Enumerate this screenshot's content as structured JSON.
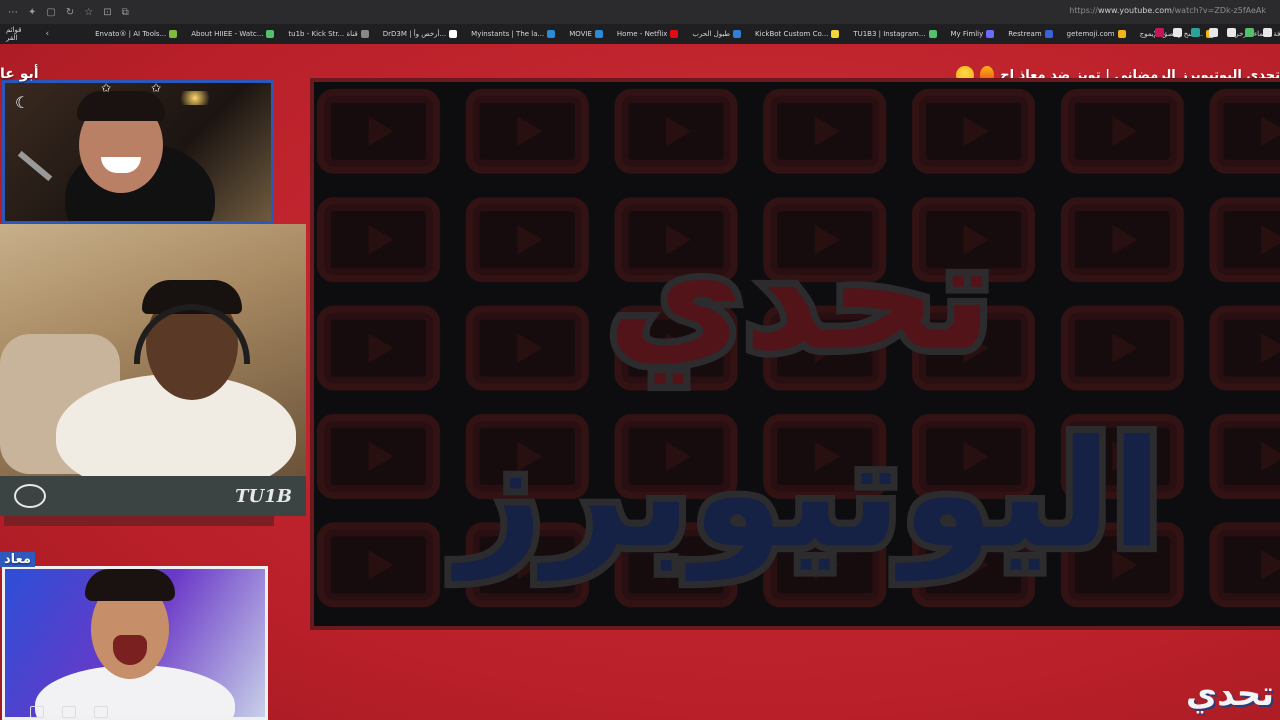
{
  "browser": {
    "url_prefix": "https://",
    "url_domain": "www.youtube.com",
    "url_rest": "/watch?v=ZDk-z5fAeAk",
    "bookmarks_left": "قوائم القر",
    "bookmarks": [
      {
        "label": "Envato® | AI Tools...",
        "color": "#7dbb3b"
      },
      {
        "label": "About HIIEE - Watc...",
        "color": "#53c06b"
      },
      {
        "label": "tu1b - Kick Str... قناة",
        "color": "#888888"
      },
      {
        "label": "DrD3M | أرخص وأ...",
        "color": "#ffffff"
      },
      {
        "label": "Myinstants | The la...",
        "color": "#2a8bd6"
      },
      {
        "label": "MOVIE",
        "color": "#2a8bd6"
      },
      {
        "label": "Home - Netflix",
        "color": "#e50914"
      },
      {
        "label": "طبول الحرب",
        "color": "#2f7fd6"
      },
      {
        "label": "KickBot Custom Co...",
        "color": "#f0d43a"
      },
      {
        "label": "TU1B3 | Instagram...",
        "color": "#53c06b"
      },
      {
        "label": "My Fimliy",
        "color": "#6a6aff"
      },
      {
        "label": "Restream",
        "color": "#3a63d8"
      },
      {
        "label": "getemoji.com",
        "color": "#f2b41a"
      },
      {
        "label": "نسخ و لصق الإيموج...",
        "color": "#f2b41a"
      },
      {
        "label": "زخرفة اسماء - زخرفة...",
        "color": "#dddddd"
      }
    ],
    "bookmark_icons_right": [
      "#c2185b",
      "#e8e8e8",
      "#2aa39a",
      "#e8e8e8",
      "#e8e8e8",
      "#53c06b",
      "#e8e8e8"
    ]
  },
  "video": {
    "title": "تحدي اليوتيوبرز الرمضاني | تويز ضد معاذ اج",
    "center_graphic_line1": "تحدي",
    "center_graphic_line2": "اليوتيوبرز",
    "cam2_logo_text": "TU1B",
    "streamer1_name": "أبو عا",
    "streamer3_name": "معاد",
    "corner_logo": "تحدي"
  }
}
